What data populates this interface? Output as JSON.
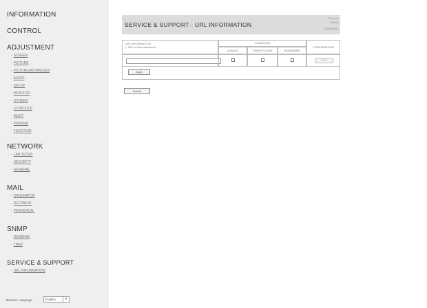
{
  "sidebar": {
    "information": "INFORMATION",
    "control": "CONTROL",
    "adjustment": {
      "label": "ADJUSTMENT",
      "items": [
        "SCREEN",
        "PICTURE",
        "PICTURE(ADVANCED)",
        "AUDIO",
        "SETUP",
        "MONITOR",
        "OTHERS",
        "SCHEDULE",
        "MULTI",
        "PIP/PbyP",
        "FUNCTION"
      ]
    },
    "network": {
      "label": "NETWORK",
      "items": [
        "LAN SETUP",
        "SECURITY",
        "GENERAL"
      ]
    },
    "mail": {
      "label": "MAIL",
      "items": [
        "ORIGINATOR",
        "RECIPIENT",
        "PERIODICAL"
      ]
    },
    "snmp": {
      "label": "SNMP",
      "items": [
        "GENERAL",
        "TRAP"
      ]
    },
    "service": {
      "label": "SERVICE & SUPPORT",
      "items": [
        "URL INFORMATION"
      ]
    },
    "language": {
      "label": "Browser Language",
      "value": "English"
    }
  },
  "header": {
    "title": "SERVICE & SUPPORT  -  URL INFORMATION",
    "model": "PN-xxxx",
    "name": "DMS4",
    "resolution": "1920x1080"
  },
  "table": {
    "url_header": "URL INFORMATION",
    "url_sub": "(* 500 or less characters)",
    "condition_header": "CONDITION",
    "conditions": [
      "ALWAYS",
      "TEMPERATURE",
      "HARDWARE"
    ],
    "confirmation_header": "CONFIRMATION",
    "test_button": "TEST",
    "apply_button": "Apply",
    "url_value": ""
  },
  "reload_button": "Reload"
}
